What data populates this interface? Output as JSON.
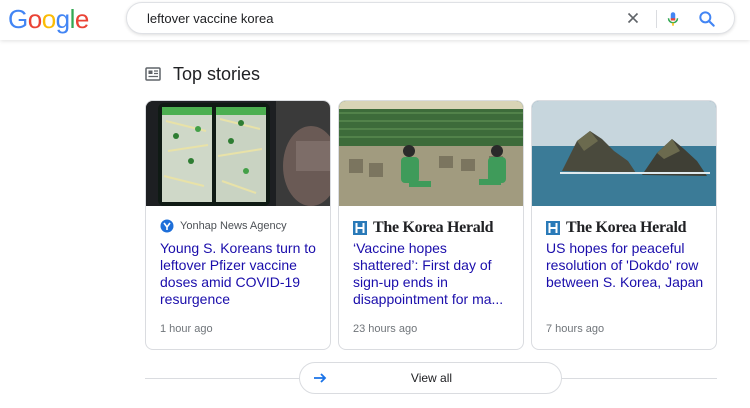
{
  "logo": {
    "letters": [
      "G",
      "o",
      "o",
      "g",
      "l",
      "e"
    ],
    "colors": [
      "#4285F4",
      "#EA4335",
      "#FBBC05",
      "#4285F4",
      "#34A853",
      "#EA4335"
    ]
  },
  "search": {
    "query": "leftover vaccine korea",
    "clear_icon": "close-icon",
    "mic_icon": "mic-icon",
    "search_icon": "search-icon"
  },
  "top_stories": {
    "title": "Top stories",
    "icon": "newspaper-icon",
    "cards": [
      {
        "source": "Yonhap News Agency",
        "headline": "Young S. Koreans turn to leftover Pfizer vaccine doses amid COVID-19 resurgence",
        "time": "1 hour ago",
        "thumb": "phone-map-image"
      },
      {
        "source": "The Korea Herald",
        "headline": "‘Vaccine hopes shattered’: First day of sign-up ends in disappointment for ma...",
        "time": "23 hours ago",
        "thumb": "vaccination-hall-image"
      },
      {
        "source": "The Korea Herald",
        "headline": "US hopes for peaceful resolution of 'Dokdo' row between S. Korea, Japan",
        "time": "7 hours ago",
        "thumb": "islands-image"
      }
    ],
    "view_all": "View all"
  },
  "colors": {
    "link": "#1a0dab",
    "border": "#dadce0",
    "meta": "#70757a"
  }
}
